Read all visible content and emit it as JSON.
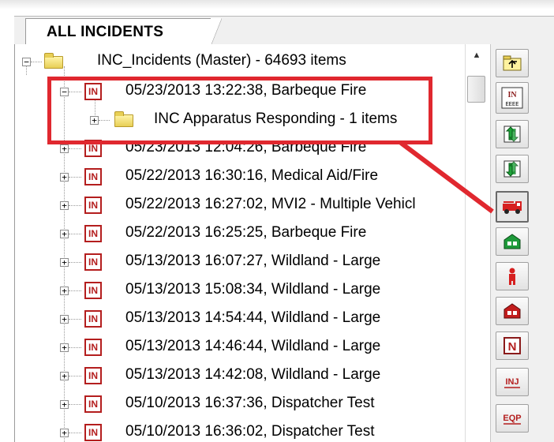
{
  "tab": {
    "label": "ALL INCIDENTS"
  },
  "tree": {
    "root": {
      "label": "INC_Incidents (Master) - 64693 items"
    },
    "selected_incident": {
      "label": "05/23/2013 13:22:38, Barbeque Fire"
    },
    "child_folder": {
      "label": "INC Apparatus Responding - 1 items"
    },
    "incidents": [
      {
        "label": "05/23/2013 12:04:26, Barbeque Fire"
      },
      {
        "label": "05/22/2013 16:30:16, Medical Aid/Fire"
      },
      {
        "label": "05/22/2013 16:27:02, MVI2 - Multiple Vehicl"
      },
      {
        "label": "05/22/2013 16:25:25, Barbeque Fire"
      },
      {
        "label": "05/13/2013 16:07:27, Wildland - Large"
      },
      {
        "label": "05/13/2013 15:08:34, Wildland - Large"
      },
      {
        "label": "05/13/2013 14:54:44, Wildland - Large"
      },
      {
        "label": "05/13/2013 14:46:44, Wildland - Large"
      },
      {
        "label": "05/13/2013 14:42:08, Wildland - Large"
      },
      {
        "label": "05/10/2013 16:37:36, Dispatcher Test"
      },
      {
        "label": "05/10/2013 16:36:02, Dispatcher Test"
      }
    ],
    "incident_icon_text": "IN"
  },
  "toolbar": {
    "buttons": [
      {
        "icon": "folder-up-icon"
      },
      {
        "icon": "incident-form-icon",
        "text_top": "IN",
        "text_bottom": "EEEE"
      },
      {
        "icon": "green-arrows-up-icon"
      },
      {
        "icon": "green-arrows-down-icon"
      },
      {
        "icon": "fire-apparatus-icon"
      },
      {
        "icon": "green-building-icon"
      },
      {
        "icon": "person-icon"
      },
      {
        "icon": "red-building-icon"
      },
      {
        "icon": "narrative-icon",
        "text": "N"
      },
      {
        "icon": "injury-icon",
        "text": "INJ"
      },
      {
        "icon": "equipment-icon",
        "text": "EQP"
      }
    ]
  },
  "colors": {
    "highlight": "#e0282f",
    "incident_icon": "#b41e1e",
    "folder": "#e8cf55"
  }
}
